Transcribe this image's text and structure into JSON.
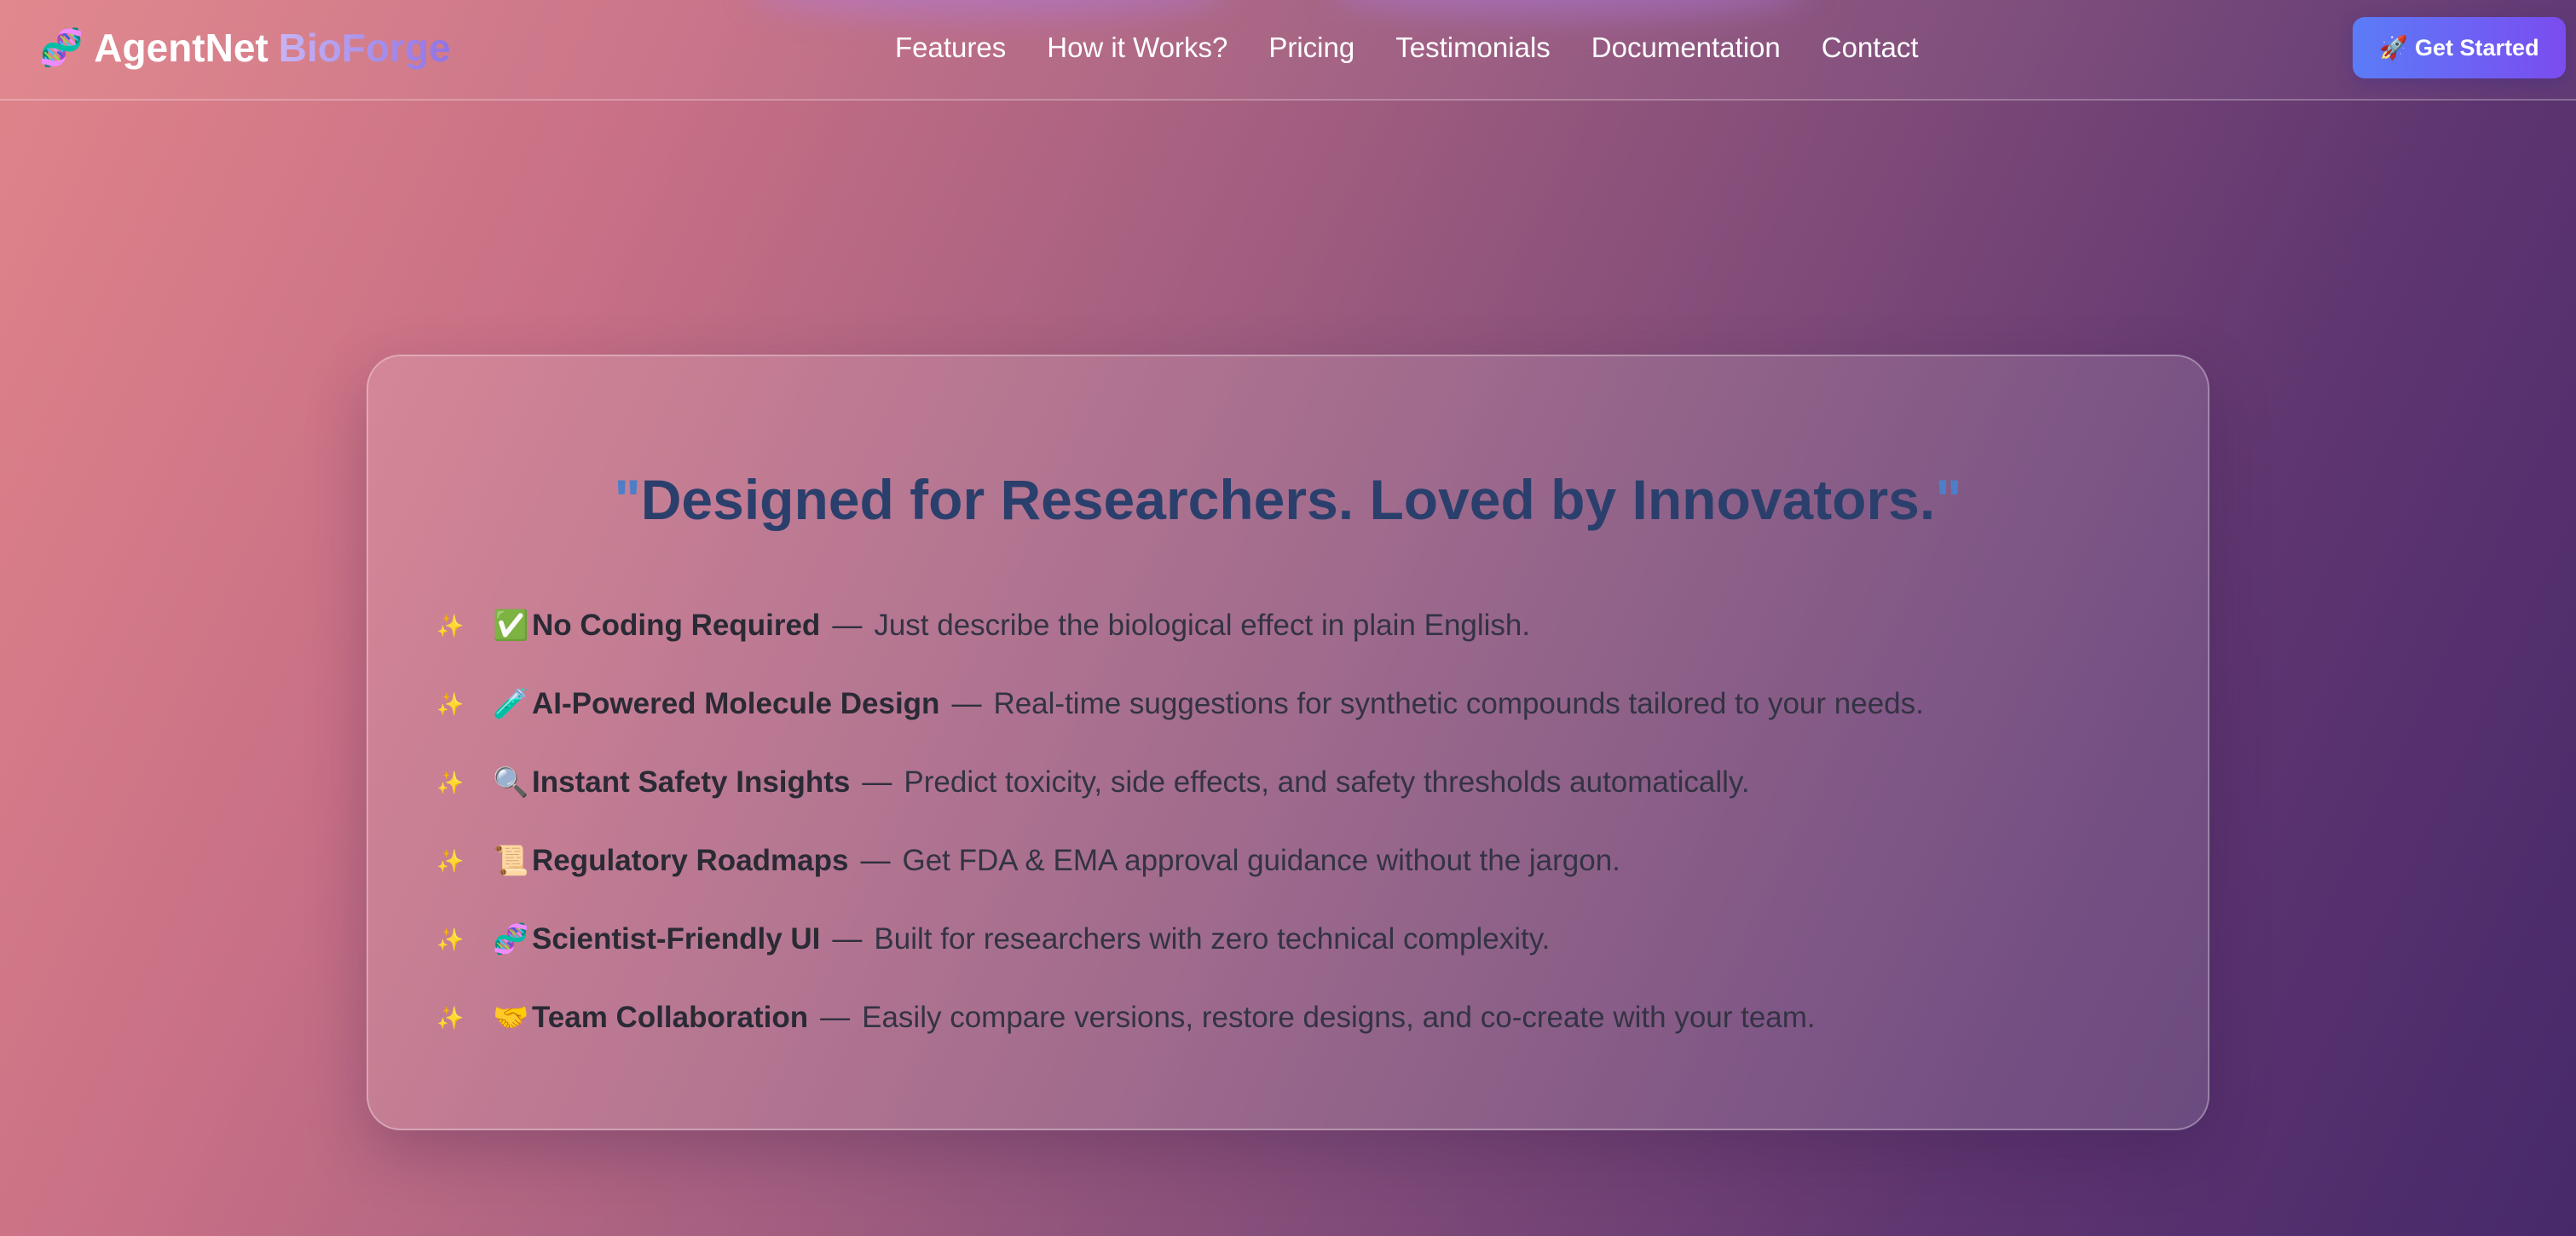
{
  "nav": {
    "logo_icon": "🧬",
    "logo_main": "AgentNet",
    "logo_accent": "BioForge",
    "links": [
      "Features",
      "How it Works?",
      "Pricing",
      "Testimonials",
      "Documentation",
      "Contact"
    ],
    "cta_icon": "🚀",
    "cta_label": "Get Started"
  },
  "card": {
    "quote_open": "\"",
    "title": "Designed for Researchers. Loved by Innovators.",
    "quote_close": "\"",
    "sparkle": "✨",
    "dash": "—",
    "features": [
      {
        "icon": "✅",
        "title": "No Coding Required",
        "desc": "Just describe the biological effect in plain English."
      },
      {
        "icon": "🧪",
        "title": "AI-Powered Molecule Design",
        "desc": "Real-time suggestions for synthetic compounds tailored to your needs."
      },
      {
        "icon": "🔍",
        "title": "Instant Safety Insights",
        "desc": "Predict toxicity, side effects, and safety thresholds automatically."
      },
      {
        "icon": "📜",
        "title": "Regulatory Roadmaps",
        "desc": "Get FDA & EMA approval guidance without the jargon."
      },
      {
        "icon": "🧬",
        "title": "Scientist-Friendly UI",
        "desc": "Built for researchers with zero technical complexity."
      },
      {
        "icon": "🤝",
        "title": "Team Collaboration",
        "desc": "Easily compare versions, restore designs, and co-create with your team."
      }
    ]
  },
  "colors": {
    "title": "#2b3f6c",
    "quote": "#4d7fc8",
    "cta_start": "#5b7cf7",
    "cta_end": "#7b4cf0"
  }
}
